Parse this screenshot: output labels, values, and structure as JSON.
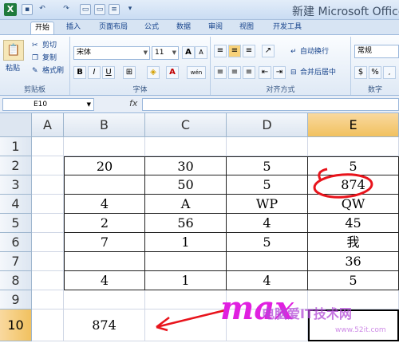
{
  "app": {
    "title": "新建 Microsoft Office",
    "logo_letter": "X",
    "brand_color": "#1f7a3d"
  },
  "tabs": [
    "开始",
    "插入",
    "页面布局",
    "公式",
    "数据",
    "审阅",
    "视图",
    "开发工具"
  ],
  "active_tab": "开始",
  "ribbon": {
    "clipboard": {
      "paste": "粘贴",
      "cut": "剪切",
      "copy": "复制",
      "format_painter": "格式刷",
      "label": "剪贴板"
    },
    "font": {
      "name": "宋体",
      "size": "11",
      "grow": "A",
      "shrink": "A",
      "label": "字体",
      "bold": "B",
      "italic": "I",
      "underline": "U",
      "wen": "wén"
    },
    "alignment": {
      "wrap": "自动换行",
      "merge": "合并后居中",
      "label": "对齐方式"
    },
    "number": {
      "format": "常规",
      "label": "数字"
    }
  },
  "formula_bar": {
    "name_box": "E10",
    "fx": "fx",
    "value": ""
  },
  "columns": [
    "A",
    "B",
    "C",
    "D",
    "E"
  ],
  "selected_column": "E",
  "rows": [
    "1",
    "2",
    "3",
    "4",
    "5",
    "6",
    "7",
    "8",
    "9",
    "10"
  ],
  "selected_row": "10",
  "cells": {
    "r2": [
      "",
      "20",
      "30",
      "5",
      "5"
    ],
    "r3": [
      "",
      "",
      "50",
      "5",
      "874"
    ],
    "r4": [
      "",
      "4",
      "A",
      "WP",
      "QW"
    ],
    "r5": [
      "",
      "2",
      "56",
      "4",
      "45"
    ],
    "r6": [
      "",
      "7",
      "1",
      "5",
      "我"
    ],
    "r7": [
      "",
      "",
      "",
      "",
      "36"
    ],
    "r8": [
      "",
      "4",
      "1",
      "4",
      "5"
    ],
    "r10": [
      "",
      "874",
      "",
      "",
      ""
    ]
  },
  "annotation": {
    "text": "max",
    "color": "#e020e0",
    "circle_color": "#e8141c",
    "arrow_color": "#e8141c"
  },
  "watermark": {
    "text": "电脑爱IT技术网",
    "url": "www.52it.com"
  }
}
